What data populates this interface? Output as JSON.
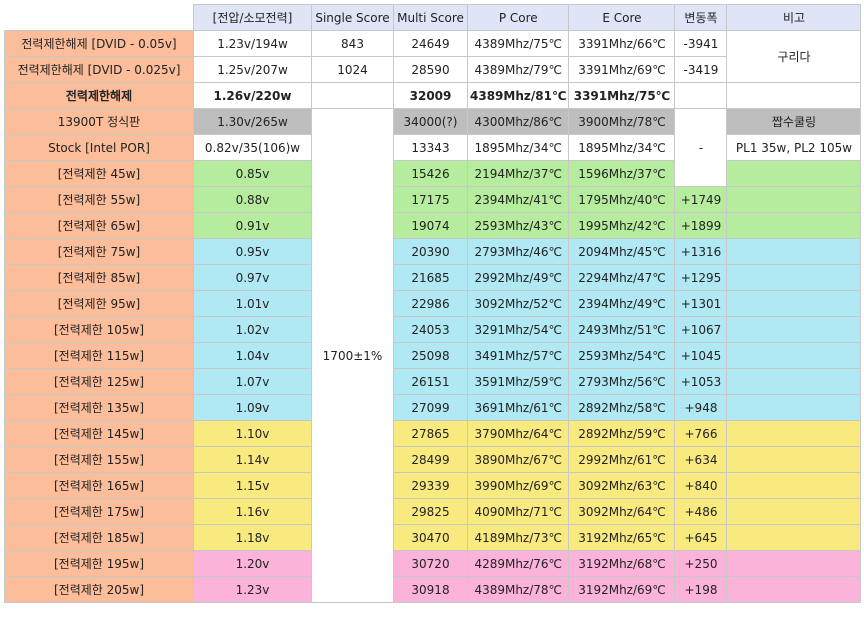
{
  "colors": {
    "header": "#dfe5f7",
    "label": "#fcbd9a",
    "white": "#ffffff",
    "gray": "#bebebe",
    "green": "#b6ec9d",
    "cyan": "#b0e8f4",
    "yellow": "#f9ea80",
    "pink": "#fbb3da"
  },
  "header": [
    "",
    "[전압/소모전력]",
    "Single Score",
    "Multi Score",
    "P Core",
    "E Core",
    "변동폭",
    "비고"
  ],
  "single_merged": "1700±1%",
  "delta_merged": "-",
  "note_guri": "구리다",
  "note_cooling": "짭수쿨링",
  "note_pl": "PL1 35w, PL2 105w",
  "rows": [
    {
      "label": "전력제한해제 [DVID - 0.05v]",
      "voltage": "1.23v/194w",
      "single": "843",
      "multi": "24649",
      "pcore": "4389Mhz/75℃",
      "ecore": "3391Mhz/66℃",
      "delta": "-3941",
      "color": "white",
      "bold": false
    },
    {
      "label": "전력제한해제 [DVID - 0.025v]",
      "voltage": "1.25v/207w",
      "single": "1024",
      "multi": "28590",
      "pcore": "4389Mhz/79℃",
      "ecore": "3391Mhz/69℃",
      "delta": "-3419",
      "color": "white",
      "bold": false
    },
    {
      "label": "전력제한해제",
      "voltage": "1.26v/220w",
      "single": "",
      "multi": "32009",
      "pcore": "4389Mhz/81℃",
      "ecore": "3391Mhz/75℃",
      "delta": "",
      "color": "white",
      "bold": true
    },
    {
      "label": "13900T 정식판",
      "voltage": "1.30v/265w",
      "single": "",
      "multi": "34000(?)",
      "pcore": "4300Mhz/86℃",
      "ecore": "3900Mhz/78℃",
      "delta": "",
      "color": "gray",
      "bold": false
    },
    {
      "label": "Stock [Intel POR]",
      "voltage": "0.82v/35(106)w",
      "single": "",
      "multi": "13343",
      "pcore": "1895Mhz/34℃",
      "ecore": "1895Mhz/34℃",
      "delta": "",
      "color": "white",
      "bold": false
    },
    {
      "label": "[전력제한 45w]",
      "voltage": "0.85v",
      "multi": "15426",
      "pcore": "2194Mhz/37℃",
      "ecore": "1596Mhz/37℃",
      "delta": "",
      "color": "green"
    },
    {
      "label": "[전력제한 55w]",
      "voltage": "0.88v",
      "multi": "17175",
      "pcore": "2394Mhz/41℃",
      "ecore": "1795Mhz/40℃",
      "delta": "+1749",
      "color": "green"
    },
    {
      "label": "[전력제한 65w]",
      "voltage": "0.91v",
      "multi": "19074",
      "pcore": "2593Mhz/43℃",
      "ecore": "1995Mhz/42℃",
      "delta": "+1899",
      "color": "green"
    },
    {
      "label": "[전력제한 75w]",
      "voltage": "0.95v",
      "multi": "20390",
      "pcore": "2793Mhz/46℃",
      "ecore": "2094Mhz/45℃",
      "delta": "+1316",
      "color": "cyan"
    },
    {
      "label": "[전력제한 85w]",
      "voltage": "0.97v",
      "multi": "21685",
      "pcore": "2992Mhz/49℃",
      "ecore": "2294Mhz/47℃",
      "delta": "+1295",
      "color": "cyan"
    },
    {
      "label": "[전력제한 95w]",
      "voltage": "1.01v",
      "multi": "22986",
      "pcore": "3092Mhz/52℃",
      "ecore": "2394Mhz/49℃",
      "delta": "+1301",
      "color": "cyan"
    },
    {
      "label": "[전력제한 105w]",
      "voltage": "1.02v",
      "multi": "24053",
      "pcore": "3291Mhz/54℃",
      "ecore": "2493Mhz/51℃",
      "delta": "+1067",
      "color": "cyan"
    },
    {
      "label": "[전력제한 115w]",
      "voltage": "1.04v",
      "multi": "25098",
      "pcore": "3491Mhz/57℃",
      "ecore": "2593Mhz/54℃",
      "delta": "+1045",
      "color": "cyan"
    },
    {
      "label": "[전력제한 125w]",
      "voltage": "1.07v",
      "multi": "26151",
      "pcore": "3591Mhz/59℃",
      "ecore": "2793Mhz/56℃",
      "delta": "+1053",
      "color": "cyan"
    },
    {
      "label": "[전력제한 135w]",
      "voltage": "1.09v",
      "multi": "27099",
      "pcore": "3691Mhz/61℃",
      "ecore": "2892Mhz/58℃",
      "delta": "+948",
      "color": "cyan"
    },
    {
      "label": "[전력제한 145w]",
      "voltage": "1.10v",
      "multi": "27865",
      "pcore": "3790Mhz/64℃",
      "ecore": "2892Mhz/59℃",
      "delta": "+766",
      "color": "yellow"
    },
    {
      "label": "[전력제한 155w]",
      "voltage": "1.14v",
      "multi": "28499",
      "pcore": "3890Mhz/67℃",
      "ecore": "2992Mhz/61℃",
      "delta": "+634",
      "color": "yellow"
    },
    {
      "label": "[전력제한 165w]",
      "voltage": "1.15v",
      "multi": "29339",
      "pcore": "3990Mhz/69℃",
      "ecore": "3092Mhz/63℃",
      "delta": "+840",
      "color": "yellow"
    },
    {
      "label": "[전력제한 175w]",
      "voltage": "1.16v",
      "multi": "29825",
      "pcore": "4090Mhz/71℃",
      "ecore": "3092Mhz/64℃",
      "delta": "+486",
      "color": "yellow"
    },
    {
      "label": "[전력제한 185w]",
      "voltage": "1.18v",
      "multi": "30470",
      "pcore": "4189Mhz/73℃",
      "ecore": "3192Mhz/65℃",
      "delta": "+645",
      "color": "yellow"
    },
    {
      "label": "[전력제한 195w]",
      "voltage": "1.20v",
      "multi": "30720",
      "pcore": "4289Mhz/76℃",
      "ecore": "3192Mhz/68℃",
      "delta": "+250",
      "color": "pink"
    },
    {
      "label": "[전력제한 205w]",
      "voltage": "1.23v",
      "multi": "30918",
      "pcore": "4389Mhz/78℃",
      "ecore": "3192Mhz/69℃",
      "delta": "+198",
      "color": "pink"
    }
  ]
}
